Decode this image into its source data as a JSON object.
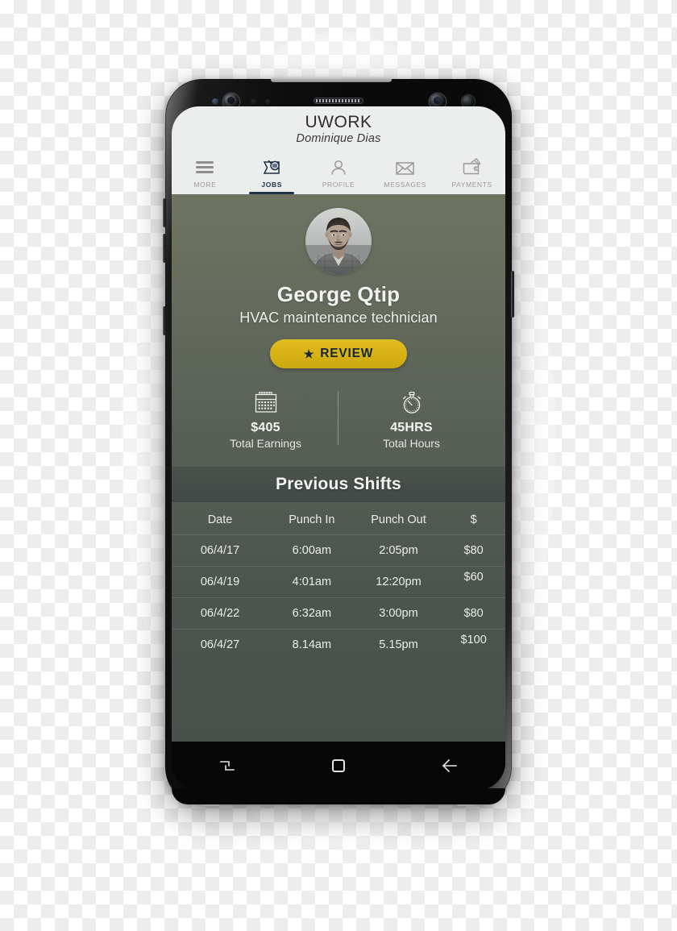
{
  "app": {
    "title": "UWORK",
    "account_name": "Dominique Dias"
  },
  "tabs": [
    {
      "label": "MORE",
      "icon": "hamburger-icon",
      "active": false
    },
    {
      "label": "JOBS",
      "icon": "jobs-icon",
      "active": true
    },
    {
      "label": "PROFILE",
      "icon": "profile-icon",
      "active": false
    },
    {
      "label": "MESSAGES",
      "icon": "envelope-icon",
      "active": false
    },
    {
      "label": "PAYMENTS",
      "icon": "wallet-icon",
      "active": false
    }
  ],
  "profile": {
    "avatar_alt": "photo of George Qtip",
    "name": "George Qtip",
    "role": "HVAC maintenance technician",
    "review_button": "REVIEW",
    "review_star": "★"
  },
  "stats": [
    {
      "icon": "calendar-icon",
      "value": "$405",
      "label": "Total Earnings"
    },
    {
      "icon": "stopwatch-icon",
      "value": "45HRS",
      "label": "Total Hours"
    }
  ],
  "shifts_section": {
    "title": "Previous Shifts",
    "columns": [
      "Date",
      "Punch In",
      "Punch Out",
      "$"
    ],
    "rows": [
      {
        "date": "06/4/17",
        "punch_in": "6:00am",
        "punch_out": "2:05pm",
        "amount": "$80"
      },
      {
        "date": "06/4/19",
        "punch_in": "4:01am",
        "punch_out": "12:20pm",
        "amount": "$60"
      },
      {
        "date": "06/4/22",
        "punch_in": "6:32am",
        "punch_out": "3:00pm",
        "amount": "$80"
      },
      {
        "date": "06/4/27",
        "punch_in": "8.14am",
        "punch_out": "5.15pm",
        "amount": "$100"
      }
    ]
  },
  "android_nav": [
    {
      "name": "recents-icon"
    },
    {
      "name": "home-icon"
    },
    {
      "name": "back-icon"
    }
  ],
  "colors": {
    "accent_yellow": "#d6b216",
    "accent_navy": "#1e3246",
    "screen_top_green": "#6e7361",
    "screen_bottom_green": "#49514c",
    "header_bg": "#eceded"
  }
}
